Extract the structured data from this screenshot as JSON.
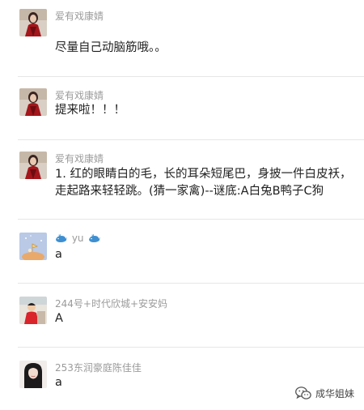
{
  "comments": [
    {
      "nickname": "爱有戏康婧",
      "avatar": "portrait-red-dress-avatar",
      "lines": [
        "尽量自己动脑筋哦。。"
      ]
    },
    {
      "nickname": "爱有戏康婧",
      "avatar": "portrait-red-dress-avatar",
      "lines": [
        "提来啦！！！"
      ]
    },
    {
      "nickname": "爱有戏康婧",
      "avatar": "portrait-red-dress-avatar",
      "lines": [
        "1. 红的眼睛白的毛，长的耳朵短尾巴，身披一件白皮袄，",
        "走起路来轻轻跳。(猜一家禽)--谜底:A白兔B鸭子C狗"
      ]
    },
    {
      "nickname": "yu",
      "avatar": "cartoon-planet-avatar",
      "nickname_icons": [
        "whale-icon",
        "whale-icon"
      ],
      "lines": [
        "a"
      ]
    },
    {
      "nickname": "244号+时代欣城+安安妈",
      "avatar": "child-photo-avatar",
      "lines": [
        "A"
      ]
    },
    {
      "nickname": "253东润豪庭陈佳佳",
      "avatar": "woman-portrait-avatar",
      "lines": [
        "a"
      ]
    }
  ],
  "watermark": {
    "icon": "wechat-icon",
    "text": "成华姐妹"
  },
  "colors": {
    "nickname": "#9b9b9b",
    "content": "#1f1f1f",
    "divider": "#e6e6e6",
    "whale": "#3d8fd1"
  }
}
